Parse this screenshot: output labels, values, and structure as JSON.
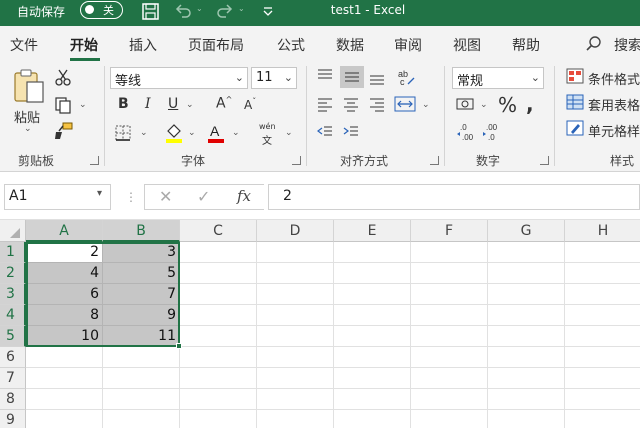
{
  "titlebar": {
    "autosave_label": "自动保存",
    "autosave_state": "关",
    "window_title": "test1  -  Excel",
    "icons": [
      "save-icon",
      "undo-icon",
      "redo-icon",
      "customize-quick-access-icon"
    ]
  },
  "tabs": [
    {
      "label": "文件"
    },
    {
      "label": "开始",
      "active": true
    },
    {
      "label": "插入"
    },
    {
      "label": "页面布局"
    },
    {
      "label": "公式"
    },
    {
      "label": "数据"
    },
    {
      "label": "审阅"
    },
    {
      "label": "视图"
    },
    {
      "label": "帮助"
    },
    {
      "label": "搜索"
    }
  ],
  "ribbon": {
    "clipboard": {
      "label": "剪贴板",
      "paste_label": "粘贴"
    },
    "font": {
      "label": "字体",
      "font_name": "等线",
      "font_size": "11",
      "wen_top": "wén",
      "wen_bottom": "文"
    },
    "alignment": {
      "label": "对齐方式"
    },
    "number": {
      "label": "数字",
      "format": "常规"
    },
    "styles": {
      "label": "样式",
      "conditional_format": "条件格式",
      "table_format": "套用表格",
      "cell_styles": "单元格样"
    }
  },
  "formula_bar": {
    "name_box": "A1",
    "formula": "2"
  },
  "sheet": {
    "columns": [
      "A",
      "B",
      "C",
      "D",
      "E",
      "F",
      "G",
      "H"
    ],
    "rows": [
      "1",
      "2",
      "3",
      "4",
      "5",
      "6",
      "7",
      "8",
      "9"
    ],
    "cells": {
      "A1": "2",
      "B1": "3",
      "A2": "4",
      "B2": "5",
      "A3": "6",
      "B3": "7",
      "A4": "8",
      "B4": "9",
      "A5": "10",
      "B5": "11"
    },
    "selection": "A1:B5",
    "accent_color": "#217346"
  }
}
